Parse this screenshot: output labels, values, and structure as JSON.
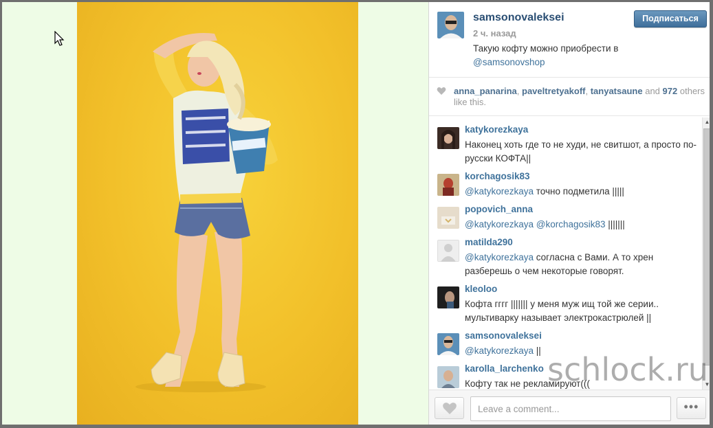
{
  "post": {
    "username": "samsonovaleksei",
    "time_ago": "2 ч. назад",
    "caption": "Такую кофту можно приобрести в",
    "caption_mention": "@samsonovshop",
    "follow_label": "Подписаться"
  },
  "likes": {
    "user1": "anna_panarina",
    "user2": "paveltretyakoff",
    "user3": "tanyatsaune",
    "and_word": "and",
    "count": "972",
    "suffix": "others like this."
  },
  "comments": [
    {
      "user": "katykorezkaya",
      "mention": "",
      "text": "Наконец хоть где то не худи, не свитшот, а просто по-русски КОФТА||"
    },
    {
      "user": "korchagosik83",
      "mention": "@katykorezkaya",
      "text": "точно подметила |||||"
    },
    {
      "user": "popovich_anna",
      "mention": "@katykorezkaya @korchagosik83",
      "text": "|||||||"
    },
    {
      "user": "matilda290",
      "mention": "@katykorezkaya",
      "text": "согласна с Вами. А то хрен разберешь о чем некоторые говорят."
    },
    {
      "user": "kleoloo",
      "mention": "",
      "text": "Кофта гггг ||||||| у меня муж ищ той же серии.. мультиварку называет электрокастрюлей ||"
    },
    {
      "user": "samsonovaleksei",
      "mention": "@katykorezkaya",
      "text": "||"
    },
    {
      "user": "karolla_larchenko",
      "mention": "",
      "text": "Кофту так не рекламируют((("
    }
  ],
  "footer": {
    "comment_placeholder": "Leave a comment...",
    "more_label": "•••"
  },
  "watermark": "schlock.ru",
  "icons": {
    "heart": "heart-icon",
    "more": "more-dots-icon",
    "cursor": "mouse-cursor-icon"
  },
  "colors": {
    "link_blue": "#3f729b",
    "username_blue": "#2a4e73",
    "follow_button": "#4a7aa5",
    "photo_background": "#f2c02a",
    "left_background": "#eefce6"
  }
}
